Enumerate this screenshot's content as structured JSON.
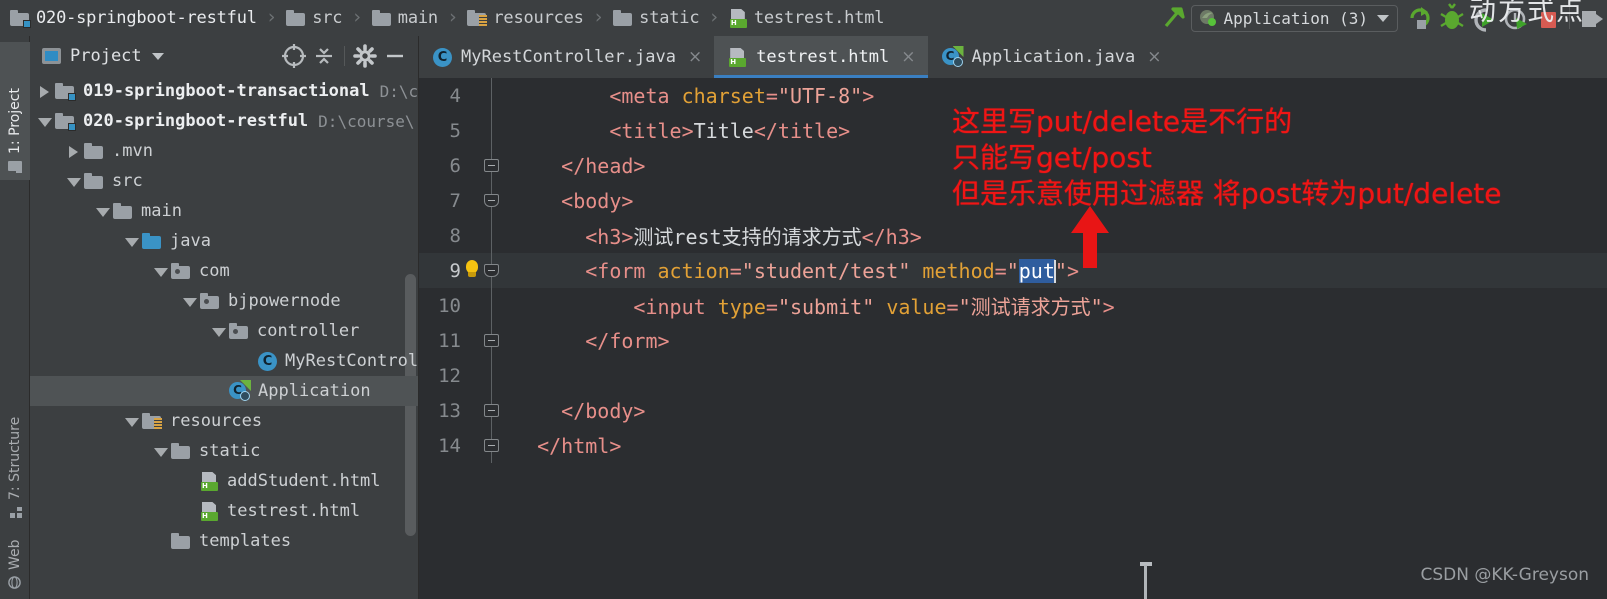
{
  "breadcrumb": {
    "items": [
      {
        "label": "020-springboot-restful",
        "icon": "module-folder-icon"
      },
      {
        "label": "src",
        "icon": "folder-icon"
      },
      {
        "label": "main",
        "icon": "folder-icon"
      },
      {
        "label": "resources",
        "icon": "resources-folder-icon"
      },
      {
        "label": "static",
        "icon": "folder-icon"
      },
      {
        "label": "testrest.html",
        "icon": "html-file-icon"
      }
    ],
    "separator": "›"
  },
  "toolbar": {
    "build_icon": "hammer-icon",
    "run_config": {
      "label": "Application (3)",
      "icon": "spring-run-config-icon",
      "caret": "chevron-down-icon"
    },
    "icons": [
      "rerun-icon",
      "debug-icon",
      "run-with-coverage-icon",
      "profile-icon",
      "stop-icon",
      "updates-icon"
    ],
    "overlay_text": "动方式点"
  },
  "left_strip": {
    "tabs": [
      {
        "label": "1: Project",
        "icon": "project-icon",
        "active": true
      },
      {
        "label": "7: Structure",
        "icon": "structure-icon",
        "active": false
      },
      {
        "label": "Web",
        "icon": "web-icon",
        "active": false
      }
    ]
  },
  "project_panel": {
    "title": "Project",
    "title_caret": "chevron-down-icon",
    "header_icons": [
      "locate-file-icon",
      "collapse-all-icon",
      "settings-gear-icon",
      "hide-panel-icon"
    ],
    "tree": [
      {
        "indent": 0,
        "label": "019-springboot-transactional",
        "path": "D:\\c",
        "icon": "module-folder-icon",
        "arrow": "collapsed",
        "bold": true,
        "selected": false
      },
      {
        "indent": 0,
        "label": "020-springboot-restful",
        "path": "D:\\course\\",
        "icon": "module-folder-icon",
        "arrow": "expanded",
        "bold": true,
        "selected": false
      },
      {
        "indent": 1,
        "label": ".mvn",
        "path": "",
        "icon": "folder-icon",
        "arrow": "collapsed",
        "bold": false,
        "selected": false
      },
      {
        "indent": 1,
        "label": "src",
        "path": "",
        "icon": "folder-icon",
        "arrow": "expanded",
        "bold": false,
        "selected": false
      },
      {
        "indent": 2,
        "label": "main",
        "path": "",
        "icon": "folder-icon",
        "arrow": "expanded",
        "bold": false,
        "selected": false
      },
      {
        "indent": 3,
        "label": "java",
        "path": "",
        "icon": "source-root-folder-icon",
        "arrow": "expanded",
        "bold": false,
        "selected": false
      },
      {
        "indent": 4,
        "label": "com",
        "path": "",
        "icon": "package-folder-icon",
        "arrow": "expanded",
        "bold": false,
        "selected": false
      },
      {
        "indent": 5,
        "label": "bjpowernode",
        "path": "",
        "icon": "package-folder-icon",
        "arrow": "expanded",
        "bold": false,
        "selected": false
      },
      {
        "indent": 6,
        "label": "controller",
        "path": "",
        "icon": "package-folder-icon",
        "arrow": "expanded",
        "bold": false,
        "selected": false
      },
      {
        "indent": 7,
        "label": "MyRestControl",
        "path": "",
        "icon": "java-class-icon",
        "arrow": "none",
        "bold": false,
        "selected": false
      },
      {
        "indent": 6,
        "label": "Application",
        "path": "",
        "icon": "spring-boot-class-icon",
        "arrow": "none",
        "bold": false,
        "selected": true
      },
      {
        "indent": 3,
        "label": "resources",
        "path": "",
        "icon": "resources-folder-icon",
        "arrow": "expanded",
        "bold": false,
        "selected": false
      },
      {
        "indent": 4,
        "label": "static",
        "path": "",
        "icon": "folder-icon",
        "arrow": "expanded",
        "bold": false,
        "selected": false
      },
      {
        "indent": 5,
        "label": "addStudent.html",
        "path": "",
        "icon": "html-file-icon",
        "arrow": "none",
        "bold": false,
        "selected": false
      },
      {
        "indent": 5,
        "label": "testrest.html",
        "path": "",
        "icon": "html-file-icon",
        "arrow": "none",
        "bold": false,
        "selected": false
      },
      {
        "indent": 4,
        "label": "templates",
        "path": "",
        "icon": "folder-icon",
        "arrow": "none",
        "bold": false,
        "selected": false
      }
    ]
  },
  "editor": {
    "tabs": [
      {
        "label": "MyRestController.java",
        "icon": "java-class-icon",
        "active": false,
        "close": "×"
      },
      {
        "label": "testrest.html",
        "icon": "html-file-icon",
        "active": true,
        "close": "×"
      },
      {
        "label": "Application.java",
        "icon": "spring-boot-class-icon",
        "active": false,
        "close": "×"
      }
    ],
    "lines": [
      {
        "num": "4",
        "current": false,
        "fold": "none",
        "bulb": false,
        "spans": [
          {
            "t": "        ",
            "c": "plain"
          },
          {
            "t": "<meta ",
            "c": "tag"
          },
          {
            "t": "charset",
            "c": "attrn"
          },
          {
            "t": "=",
            "c": "tag"
          },
          {
            "t": "\"UTF-8\"",
            "c": "attrv"
          },
          {
            "t": ">",
            "c": "tag"
          }
        ]
      },
      {
        "num": "5",
        "current": false,
        "fold": "none",
        "bulb": false,
        "spans": [
          {
            "t": "        ",
            "c": "plain"
          },
          {
            "t": "<title>",
            "c": "tag"
          },
          {
            "t": "Title",
            "c": "plain"
          },
          {
            "t": "</title>",
            "c": "tag"
          }
        ]
      },
      {
        "num": "6",
        "current": false,
        "fold": "box",
        "bulb": false,
        "spans": [
          {
            "t": "    ",
            "c": "plain"
          },
          {
            "t": "</head>",
            "c": "tag"
          }
        ]
      },
      {
        "num": "7",
        "current": false,
        "fold": "boxdn",
        "bulb": false,
        "spans": [
          {
            "t": "    ",
            "c": "plain"
          },
          {
            "t": "<body>",
            "c": "tag"
          }
        ]
      },
      {
        "num": "8",
        "current": false,
        "fold": "none",
        "bulb": false,
        "spans": [
          {
            "t": "      ",
            "c": "plain"
          },
          {
            "t": "<h3>",
            "c": "tag"
          },
          {
            "t": "测试rest支持的请求方式",
            "c": "plain"
          },
          {
            "t": "</h3>",
            "c": "tag"
          }
        ]
      },
      {
        "num": "9",
        "current": true,
        "fold": "boxdn",
        "bulb": true,
        "spans": [
          {
            "t": "      ",
            "c": "plain"
          },
          {
            "t": "<form ",
            "c": "tag"
          },
          {
            "t": "action",
            "c": "attrn"
          },
          {
            "t": "=",
            "c": "tag"
          },
          {
            "t": "\"student/test\"",
            "c": "attrv"
          },
          {
            "t": " ",
            "c": "plain"
          },
          {
            "t": "method",
            "c": "attrn"
          },
          {
            "t": "=",
            "c": "tag"
          },
          {
            "t": "\"",
            "c": "attrv"
          },
          {
            "t": "put",
            "c": "sel"
          },
          {
            "t": "CARET",
            "c": "caret"
          },
          {
            "t": "\"",
            "c": "attrv"
          },
          {
            "t": ">",
            "c": "tag"
          }
        ]
      },
      {
        "num": "10",
        "current": false,
        "fold": "none",
        "bulb": false,
        "spans": [
          {
            "t": "          ",
            "c": "plain"
          },
          {
            "t": "<input ",
            "c": "tag"
          },
          {
            "t": "type",
            "c": "attrn"
          },
          {
            "t": "=",
            "c": "tag"
          },
          {
            "t": "\"submit\"",
            "c": "attrv"
          },
          {
            "t": " ",
            "c": "plain"
          },
          {
            "t": "value",
            "c": "attrn"
          },
          {
            "t": "=",
            "c": "tag"
          },
          {
            "t": "\"测试请求方式\"",
            "c": "attrv"
          },
          {
            "t": ">",
            "c": "tag"
          }
        ]
      },
      {
        "num": "11",
        "current": false,
        "fold": "box",
        "bulb": false,
        "spans": [
          {
            "t": "      ",
            "c": "plain"
          },
          {
            "t": "</form>",
            "c": "tag"
          }
        ]
      },
      {
        "num": "12",
        "current": false,
        "fold": "none",
        "bulb": false,
        "spans": []
      },
      {
        "num": "13",
        "current": false,
        "fold": "box",
        "bulb": false,
        "spans": [
          {
            "t": "    ",
            "c": "plain"
          },
          {
            "t": "</body>",
            "c": "tag"
          }
        ]
      },
      {
        "num": "14",
        "current": false,
        "fold": "box",
        "bulb": false,
        "spans": [
          {
            "t": "  ",
            "c": "plain"
          },
          {
            "t": "</html>",
            "c": "tag"
          }
        ]
      }
    ]
  },
  "annotation": {
    "color": "#f01515",
    "lines": [
      "这里写put/delete是不行的",
      "只能写get/post",
      "但是乐意使用过滤器 将post转为put/delete"
    ],
    "arrow": "red-up-arrow-annotation"
  },
  "watermark": {
    "text": "CSDN @KK-Greyson"
  }
}
